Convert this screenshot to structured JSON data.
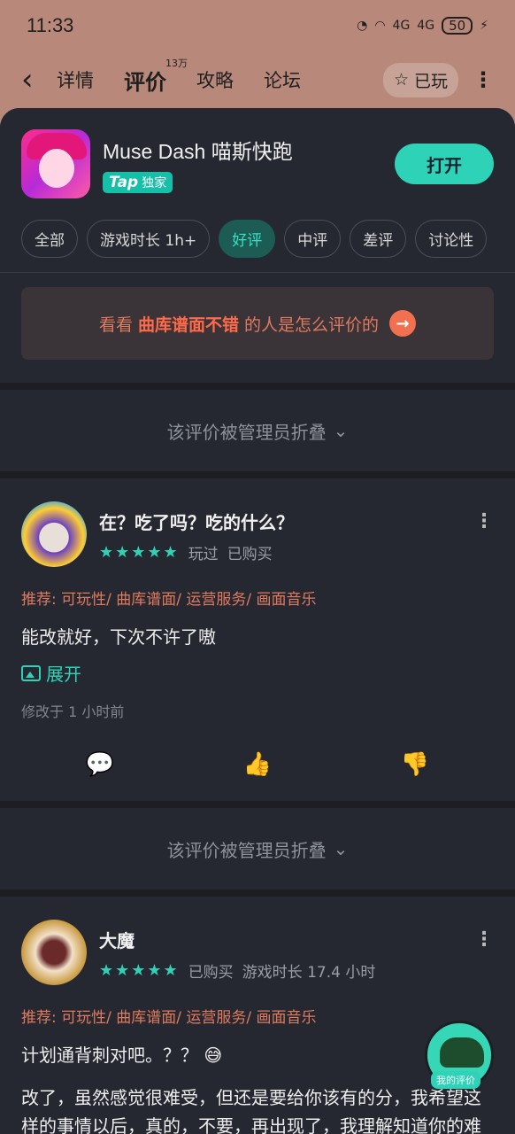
{
  "status": {
    "time": "11:33",
    "battery": "50",
    "net1": "4G",
    "net2": "4G"
  },
  "nav": {
    "back_icon": "chevron-left-icon",
    "tabs": [
      {
        "label": "详情"
      },
      {
        "label": "评价",
        "sup": "13万",
        "active": true
      },
      {
        "label": "攻略"
      },
      {
        "label": "论坛"
      }
    ],
    "played_label": "已玩"
  },
  "game": {
    "title": "Muse Dash 喵斯快跑",
    "badge_brand": "Tap",
    "badge_text": "独家",
    "open_label": "打开"
  },
  "filters": [
    {
      "label": "全部"
    },
    {
      "label": "游戏时长 1h+"
    },
    {
      "label": "好评",
      "active": true
    },
    {
      "label": "中评"
    },
    {
      "label": "差评"
    },
    {
      "label": "讨论性"
    }
  ],
  "promo": {
    "prefix": "看看",
    "keyword": "曲库谱面不错",
    "suffix": "的人是怎么评价的"
  },
  "folded_text": "该评价被管理员折叠",
  "reviews": [
    {
      "name": "在？吃了吗？吃的什么？",
      "stars": 5,
      "tags": [
        "玩过",
        "已购买"
      ],
      "recommend": "推荐: 可玩性/ 曲库谱面/ 运营服务/ 画面音乐",
      "text": "能改就好，下次不许了嗷",
      "expand_label": "展开",
      "time": "修改于 1 小时前"
    },
    {
      "name": "大魔",
      "stars": 5,
      "tags": [
        "已购买",
        "游戏时长 17.4 小时"
      ],
      "recommend": "推荐: 可玩性/ 曲库谱面/ 运营服务/ 画面音乐",
      "text": "计划通背刺对吧。？？ 😅",
      "text2": "改了，虽然感觉很难受，但还是要给你该有的分，我希望这样的事情以后，真的，不要，再出现了，我理解知道你的难处，但是我的信任不是给你用来赚钱"
    }
  ],
  "fab": {
    "label": "我的评价"
  },
  "colors": {
    "accent": "#2ed3b7",
    "promo": "#ff6b4a",
    "bg": "#1c1e24"
  }
}
